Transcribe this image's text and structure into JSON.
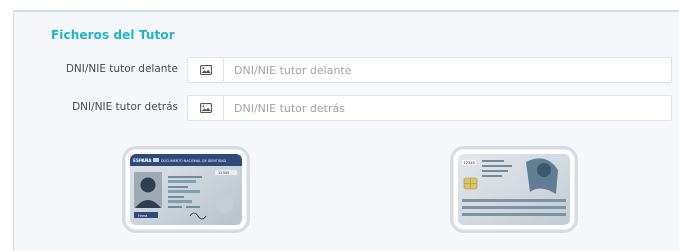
{
  "section": {
    "title": "Ficheros del Tutor"
  },
  "fields": [
    {
      "label": "DNI/NIE tutor delante",
      "placeholder": "DNI/NIE tutor delante",
      "button_icon": "image-icon"
    },
    {
      "label": "DNI/NIE tutor detrás",
      "placeholder": "DNI/NIE tutor detrás",
      "button_icon": "image-icon"
    }
  ],
  "cards": {
    "front": {
      "country": "ESPAÑA",
      "doc_title": "DOCUMENTO NACIONAL DE IDENTIDAD",
      "number": "12345",
      "signature_label": "Firma"
    },
    "back": {
      "number": "12345"
    }
  },
  "colors": {
    "accent": "#1cb5c5",
    "card_blue": "#2f4a7a",
    "panel_bg": "#f5f7fa"
  }
}
